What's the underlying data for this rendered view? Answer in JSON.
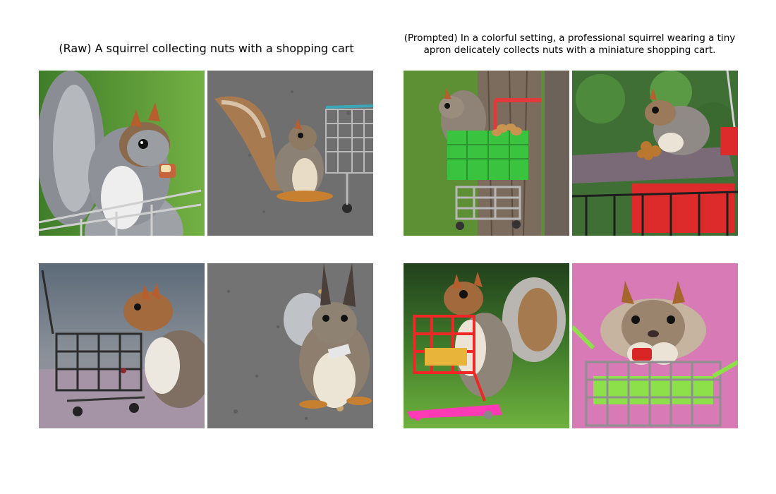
{
  "panels": [
    {
      "title": "(Raw) A squirrel collecting nuts with a shopping cart",
      "images": [
        {
          "subject": "gray squirrel eating a nut on a shopping cart, green background"
        },
        {
          "subject": "squirrel on asphalt beside a metal shopping cart"
        },
        {
          "subject": "squirrel next to a miniature dark shopping cart"
        },
        {
          "subject": "squirrel holding a nut on asphalt, close-up"
        }
      ]
    },
    {
      "title": "(Prompted) In a colorful setting, a professional squirrel wearing a tiny apron delicately collects nuts with a miniature shopping cart.",
      "images": [
        {
          "subject": "squirrel in a green and red cart full of nuts by a tree trunk"
        },
        {
          "subject": "squirrel on a board above a red shopping cart, green bokeh"
        },
        {
          "subject": "squirrel with a red and pink toy shopping cart on grass"
        },
        {
          "subject": "squirrel in a green cart against a pink background"
        }
      ]
    }
  ],
  "colors": {
    "background": "#ffffff",
    "grass": "#6aa33a",
    "asphalt": "#6e6e6e",
    "cart_red": "#e02020",
    "cart_green": "#3fc23a",
    "pink": "#d77ab5"
  }
}
